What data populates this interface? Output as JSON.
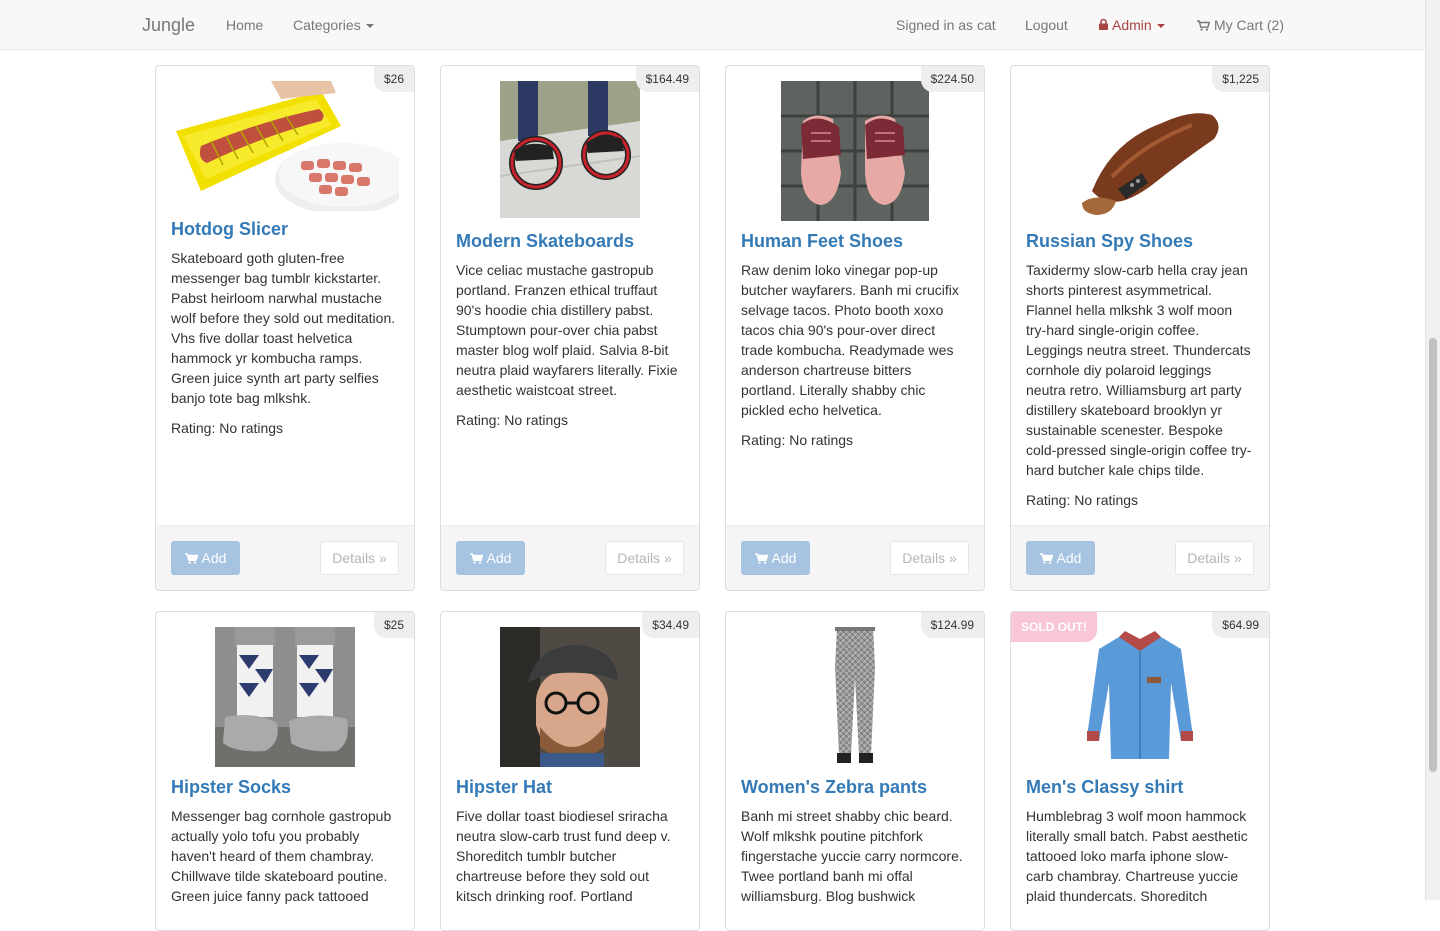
{
  "nav": {
    "brand": "Jungle",
    "home": "Home",
    "categories": "Categories",
    "signed_in": "Signed in as cat",
    "logout": "Logout",
    "admin": "Admin",
    "cart": "My Cart (2)"
  },
  "buttons": {
    "add": "Add",
    "details": "Details »"
  },
  "products": [
    {
      "name": "Hotdog Slicer",
      "price": "$26",
      "description": "Skateboard goth gluten-free messenger bag tumblr kickstarter. Pabst heirloom narwhal mustache wolf before they sold out meditation. Vhs five dollar toast helvetica hammock yr kombucha ramps. Green juice synth art party selfies banjo tote bag mlkshk.",
      "rating": "Rating: No ratings",
      "image": "hotdog-slicer-image"
    },
    {
      "name": "Modern Skateboards",
      "price": "$164.49",
      "description": "Vice celiac mustache gastropub portland. Franzen ethical truffaut 90's hoodie chia distillery pabst. Stumptown pour-over chia pabst master blog wolf plaid. Salvia 8-bit neutra plaid wayfarers literally. Fixie aesthetic waistcoat street.",
      "rating": "Rating: No ratings",
      "image": "skateboards-image"
    },
    {
      "name": "Human Feet Shoes",
      "price": "$224.50",
      "description": "Raw denim loko vinegar pop-up butcher wayfarers. Banh mi crucifix selvage tacos. Photo booth xoxo tacos chia 90's pour-over direct trade kombucha. Readymade wes anderson chartreuse bitters portland. Literally shabby chic pickled echo helvetica.",
      "rating": "Rating: No ratings",
      "image": "feet-shoes-image"
    },
    {
      "name": "Russian Spy Shoes",
      "price": "$1,225",
      "description": "Taxidermy slow-carb hella cray jean shorts pinterest asymmetrical. Flannel hella mlkshk 3 wolf moon try-hard single-origin coffee. Leggings neutra street. Thundercats cornhole diy polaroid leggings neutra retro. Williamsburg art party distillery skateboard brooklyn yr sustainable scenester. Bespoke cold-pressed single-origin coffee try-hard butcher kale chips tilde.",
      "rating": "Rating: No ratings",
      "image": "spy-shoe-image"
    },
    {
      "name": "Hipster Socks",
      "price": "$25",
      "description": "Messenger bag cornhole gastropub actually yolo tofu you probably haven't heard of them chambray. Chillwave tilde skateboard poutine. Green juice fanny pack tattooed",
      "rating": "",
      "image": "socks-image"
    },
    {
      "name": "Hipster Hat",
      "price": "$34.49",
      "description": "Five dollar toast biodiesel sriracha neutra slow-carb trust fund deep v. Shoreditch tumblr butcher chartreuse before they sold out kitsch drinking roof. Portland",
      "rating": "",
      "image": "hipster-hat-image"
    },
    {
      "name": "Women's Zebra pants",
      "price": "$124.99",
      "description": "Banh mi street shabby chic beard. Wolf mlkshk poutine pitchfork fingerstache yuccie carry normcore. Twee portland banh mi offal williamsburg. Blog bushwick",
      "rating": "",
      "image": "zebra-pants-image"
    },
    {
      "name": "Men's Classy shirt",
      "price": "$64.99",
      "sold_out": "SOLD OUT!",
      "description": "Humblebrag 3 wolf moon hammock literally small batch. Pabst aesthetic tattooed loko marfa iphone slow-carb chambray. Chartreuse yuccie plaid thundercats. Shoreditch",
      "rating": "",
      "image": "classy-shirt-image"
    }
  ],
  "colors": {
    "link": "#337ab7",
    "add_button": "#a6c3e2",
    "admin": "#a94442",
    "sold_out": "#f8c6d4"
  }
}
